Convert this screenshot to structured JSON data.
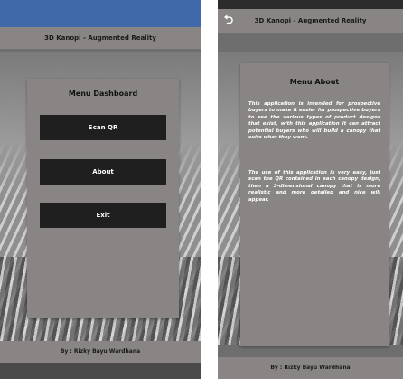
{
  "left_screen": {
    "title": "3D Kanopi - Augmented Reality",
    "menu": {
      "heading": "Menu Dashboard",
      "buttons": [
        "Scan QR",
        "About",
        "Exit"
      ]
    },
    "footer": "By : Rizky Bayu Wardhana"
  },
  "right_screen": {
    "back_icon": "back-arrow-icon",
    "back_glyph": "⮌",
    "title": "3D Kanopi - Augmented Reality",
    "about": {
      "heading": "Menu About",
      "paragraph1": "This application is intended for prospective buyers to make it easier for prospective buyers to see the various types of product designs that exist, with this application it can attract potential buyers who will build a canopy that suits what they want.",
      "paragraph2": "The use of this application is very easy, just scan the QR contained in each canopy design, then a 3-dimensional canopy that is more realistic and more detailed and nice will appear."
    },
    "footer": "By : Rizky Bayu Wardhana"
  },
  "colors": {
    "status_bar": "#3f69a8",
    "bar": "#8a8585",
    "button": "#1f1f1f",
    "panel": "#8a8585"
  }
}
